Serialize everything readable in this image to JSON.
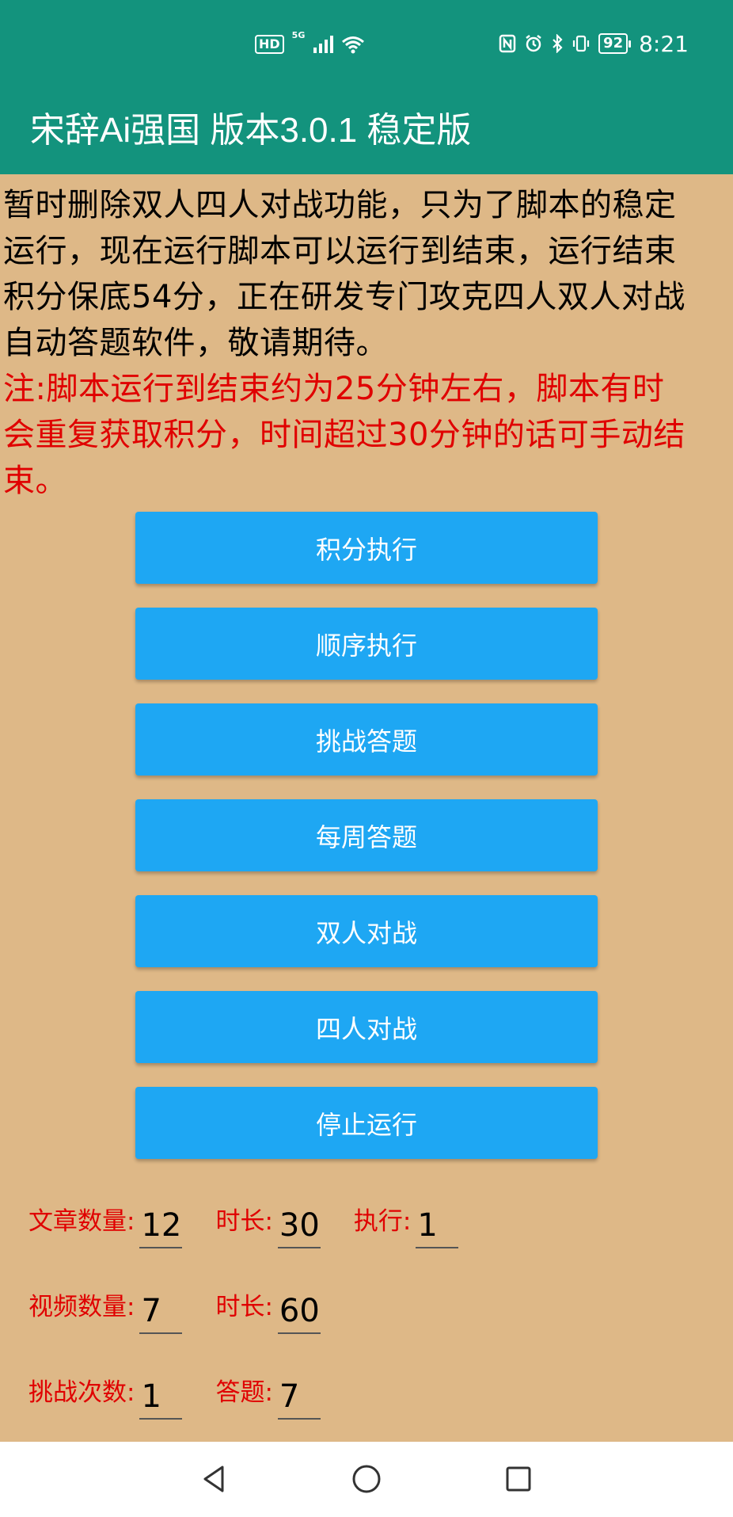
{
  "status_bar": {
    "left_icons": [
      "hd-icon",
      "signal-5g-icon",
      "wifi-icon"
    ],
    "hd_label": "HD",
    "signal_label": "5G",
    "right_icons": [
      "nfc-icon",
      "alarm-icon",
      "bluetooth-icon",
      "vibrate-icon"
    ],
    "battery": "92",
    "time": "8:21"
  },
  "app_bar": {
    "title": "宋辞Ai强国 版本3.0.1 稳定版"
  },
  "notice": {
    "lines": [
      "暂时删除双人四人对战功能，只为了脚本的稳定",
      "运行，现在运行脚本可以运行到结束，运行结束",
      "积分保底54分，正在研发专门攻克四人双人对战",
      "自动答题软件，敬请期待。"
    ]
  },
  "warning": {
    "lines": [
      "注:脚本运行到结束约为25分钟左右，脚本有时",
      "会重复获取积分，时间超过30分钟的话可手动结",
      "束。"
    ]
  },
  "buttons": [
    {
      "label": "积分执行"
    },
    {
      "label": "顺序执行"
    },
    {
      "label": "挑战答题"
    },
    {
      "label": "每周答题"
    },
    {
      "label": "双人对战"
    },
    {
      "label": "四人对战"
    },
    {
      "label": "停止运行"
    }
  ],
  "fields": {
    "article_count": {
      "label": "文章数量:",
      "value": "12"
    },
    "article_duration": {
      "label": "时长:",
      "value": "30"
    },
    "execute": {
      "label": "执行:",
      "value": "1"
    },
    "video_count": {
      "label": "视频数量:",
      "value": "7"
    },
    "video_duration": {
      "label": "时长:",
      "value": "60"
    },
    "challenge_count": {
      "label": "挑战次数:",
      "value": "1"
    },
    "answer_count": {
      "label": "答题:",
      "value": "7"
    }
  },
  "colors": {
    "app_bar": "#13937d",
    "background": "#deb887",
    "button": "#1ea7f3",
    "warning_text": "#e00000"
  }
}
